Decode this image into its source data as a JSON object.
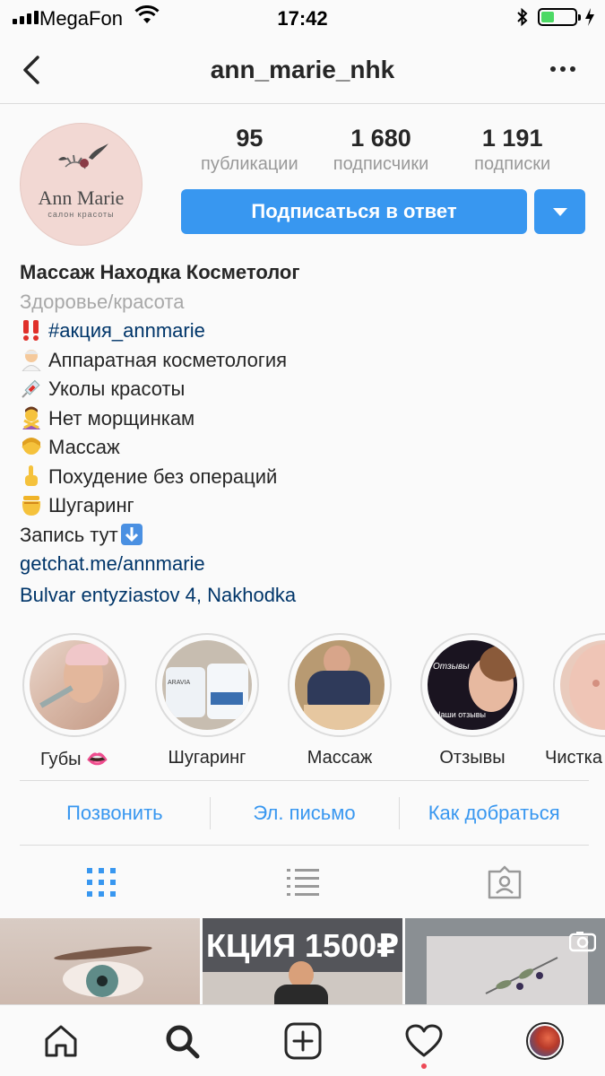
{
  "status_bar": {
    "carrier": "MegaFon",
    "time": "17:42"
  },
  "nav": {
    "username": "ann_marie_nhk"
  },
  "avatar": {
    "logo_text": "Ann Marie",
    "logo_sub": "салон красоты"
  },
  "stats": [
    {
      "value": "95",
      "label": "публикации"
    },
    {
      "value": "1 680",
      "label": "подписчики"
    },
    {
      "value": "1 191",
      "label": "подписки"
    }
  ],
  "follow_button": "Подписаться в ответ",
  "bio": {
    "name": "Массаж Находка Косметолог",
    "category": "Здоровье/красота",
    "hashtag": "#акция_annmarie",
    "lines": [
      "Аппаратная косметология",
      "Уколы красоты",
      "Нет морщинкам",
      "Массаж",
      "Похудение без операций",
      "Шугаринг",
      "Запись тут"
    ],
    "website": "getchat.me/annmarie",
    "address": "Bulvar entyziastov 4, Nakhodka"
  },
  "highlights": [
    {
      "label": "Губы 👄"
    },
    {
      "label": "Шугаринг",
      "overlay": "ARAVIA"
    },
    {
      "label": "Массаж"
    },
    {
      "label": "Отзывы",
      "overlay": "Отзывы",
      "overlay2": "Наши отзывы"
    },
    {
      "label": "Чистка"
    }
  ],
  "contact": {
    "call": "Позвонить",
    "email": "Эл. письмо",
    "directions": "Как добраться"
  },
  "grid": {
    "cell2_text": "КЦИЯ 1500₽"
  },
  "colors": {
    "accent": "#3897f0",
    "link": "#003569",
    "notification": "#ed4956"
  }
}
